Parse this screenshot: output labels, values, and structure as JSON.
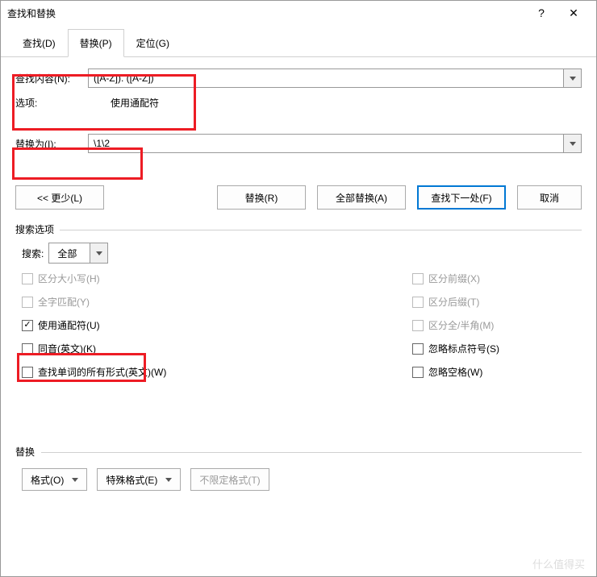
{
  "titlebar": {
    "title": "查找和替换",
    "help": "?",
    "close": "✕"
  },
  "tabs": {
    "find": "查找(D)",
    "replace": "替换(P)",
    "goto": "定位(G)"
  },
  "findSection": {
    "label": "查找内容(N):",
    "value": "([A-Z]). ([A-Z])",
    "optionsLabel": "选项:",
    "optionsValue": "使用通配符"
  },
  "replaceSection": {
    "label": "替换为(I):",
    "value": "\\1\\2"
  },
  "buttons": {
    "less": "<< 更少(L)",
    "replace": "替换(R)",
    "replaceAll": "全部替换(A)",
    "findNext": "查找下一处(F)",
    "cancel": "取消"
  },
  "searchOptions": {
    "groupLabel": "搜索选项",
    "searchLabel": "搜索:",
    "searchValue": "全部",
    "left": {
      "matchCase": "区分大小写(H)",
      "wholeWord": "全字匹配(Y)",
      "wildcards": "使用通配符(U)",
      "soundsLike": "同音(英文)(K)",
      "wordForms": "查找单词的所有形式(英文)(W)"
    },
    "right": {
      "prefix": "区分前缀(X)",
      "suffix": "区分后缀(T)",
      "fullHalf": "区分全/半角(M)",
      "ignorePunct": "忽略标点符号(S)",
      "ignoreSpace": "忽略空格(W)"
    }
  },
  "replaceFormat": {
    "groupLabel": "替换",
    "format": "格式(O)",
    "special": "特殊格式(E)",
    "noFormat": "不限定格式(T)"
  },
  "watermark": "什么值得买"
}
